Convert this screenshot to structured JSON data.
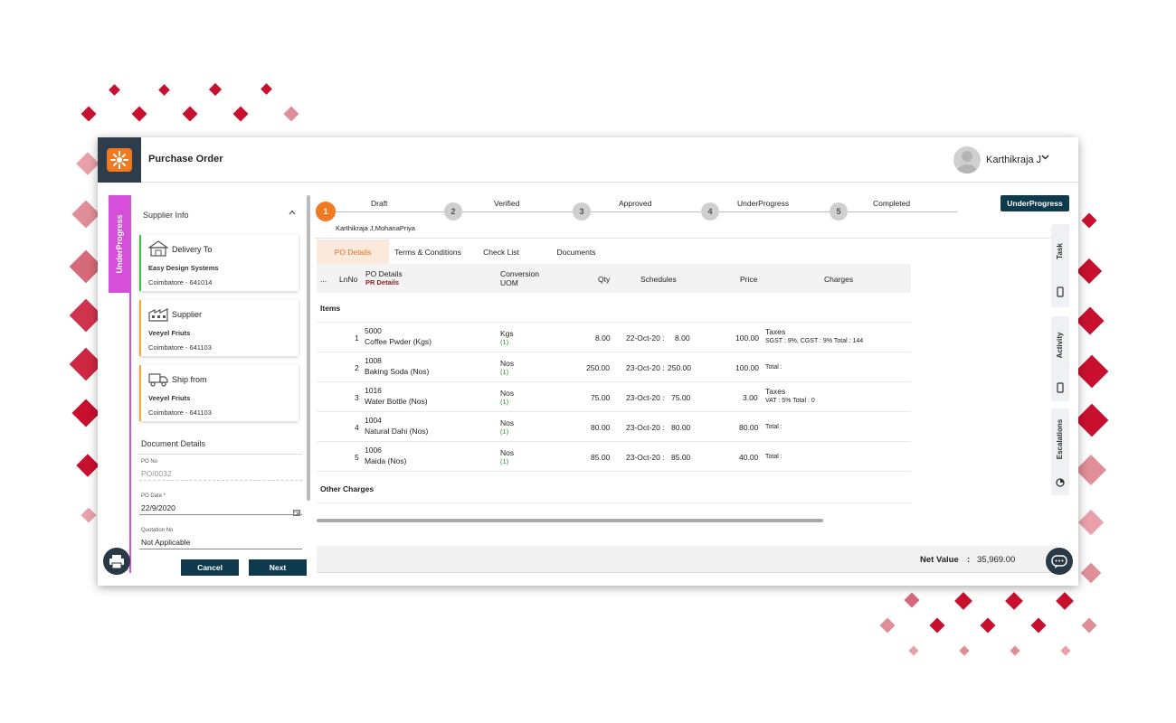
{
  "app": {
    "title": "Purchase Order"
  },
  "user": {
    "name": "Karthikraja J"
  },
  "status_tab": {
    "label": "UnderProgress"
  },
  "supplier_info": {
    "title": "Supplier Info",
    "cards": [
      {
        "title": "Delivery To",
        "name": "Easy Design Systems",
        "address": "Coimbatore - 641014",
        "accent": "#3cc04a",
        "icon": "warehouse-icon"
      },
      {
        "title": "Supplier",
        "name": "Veeyel Friuts",
        "address": "Coimbatore - 641103",
        "accent": "#f0a832",
        "icon": "factory-icon"
      },
      {
        "title": "Ship from",
        "name": "Veeyel Friuts",
        "address": "Coimbatore - 641103",
        "accent": "#f0a832",
        "icon": "truck-icon"
      }
    ]
  },
  "document_details": {
    "title": "Document Details",
    "po_no": {
      "label": "PO No",
      "value": "PO/0032"
    },
    "po_date": {
      "label": "PO Date *",
      "value": "22/9/2020"
    },
    "quotation_no": {
      "label": "Quotation No",
      "value": "Not Applicable"
    }
  },
  "buttons": {
    "cancel": "Cancel",
    "next": "Next"
  },
  "stepper": {
    "steps": [
      {
        "num": "1",
        "label": "Draft",
        "active": true
      },
      {
        "num": "2",
        "label": "Verified",
        "active": false
      },
      {
        "num": "3",
        "label": "Approved",
        "active": false
      },
      {
        "num": "4",
        "label": "UnderProgress",
        "active": false
      },
      {
        "num": "5",
        "label": "Completed",
        "active": false
      }
    ],
    "people": "Karthikraja J,MohanaPriya"
  },
  "status_badge": "UnderProgress",
  "tabs": [
    "PO Details",
    "Terms & Conditions",
    "Check List",
    "Documents"
  ],
  "grid": {
    "headers": {
      "menu": "...",
      "lnno": "LnNo",
      "po_details": "PO Details",
      "pr_details": "PR Details",
      "conversion": "Conversion",
      "uom": "UOM",
      "qty": "Qty",
      "schedules": "Schedules",
      "price": "Price",
      "charges": "Charges"
    },
    "items_label": "Items",
    "other_charges_label": "Other Charges",
    "rows": [
      {
        "ln": "1",
        "code": "5000",
        "desc": "Coffee Pwder (Kgs)",
        "uom": "Kgs",
        "conv": "(1)",
        "qty": "8.00",
        "sched_date": "22-Oct-20 :",
        "sched_qty": "8.00",
        "price": "100.00",
        "charge_title": "Taxes",
        "charge_detail": "SGST : 9%, CGST : 9% Total : 144"
      },
      {
        "ln": "2",
        "code": "1008",
        "desc": "Baking Soda (Nos)",
        "uom": "Nos",
        "conv": "(1)",
        "qty": "250.00",
        "sched_date": "23-Oct-20 :",
        "sched_qty": "250.00",
        "price": "100.00",
        "charge_title": "",
        "charge_detail": "Total :"
      },
      {
        "ln": "3",
        "code": "1016",
        "desc": "Water Bottle (Nos)",
        "uom": "Nos",
        "conv": "(1)",
        "qty": "75.00",
        "sched_date": "23-Oct-20 :",
        "sched_qty": "75.00",
        "price": "3.00",
        "charge_title": "Taxes",
        "charge_detail": "VAT : 5% Total : 0"
      },
      {
        "ln": "4",
        "code": "1004",
        "desc": "Natural Dahi (Nos)",
        "uom": "Nos",
        "conv": "(1)",
        "qty": "80.00",
        "sched_date": "23-Oct-20 :",
        "sched_qty": "80.00",
        "price": "80.00",
        "charge_title": "",
        "charge_detail": "Total :"
      },
      {
        "ln": "5",
        "code": "1006",
        "desc": "Maida (Nos)",
        "uom": "Nos",
        "conv": "(1)",
        "qty": "85.00",
        "sched_date": "23-Oct-20 :",
        "sched_qty": "85.00",
        "price": "40.00",
        "charge_title": "",
        "charge_detail": "Total :"
      }
    ]
  },
  "net": {
    "label": "Net Value",
    "sep": ":",
    "value": "35,969.00"
  },
  "right_tabs": [
    {
      "label": "Task",
      "icon": "phone-icon"
    },
    {
      "label": "Activity",
      "icon": "phone-icon"
    },
    {
      "label": "Escalations",
      "icon": "clock-icon"
    }
  ],
  "colors": {
    "accent": "#f07a22",
    "primary_button": "#0f3a4d",
    "status_tab": "#d64fd8",
    "header_dark": "#2f3d4a",
    "decor_red": "#c8102e"
  }
}
